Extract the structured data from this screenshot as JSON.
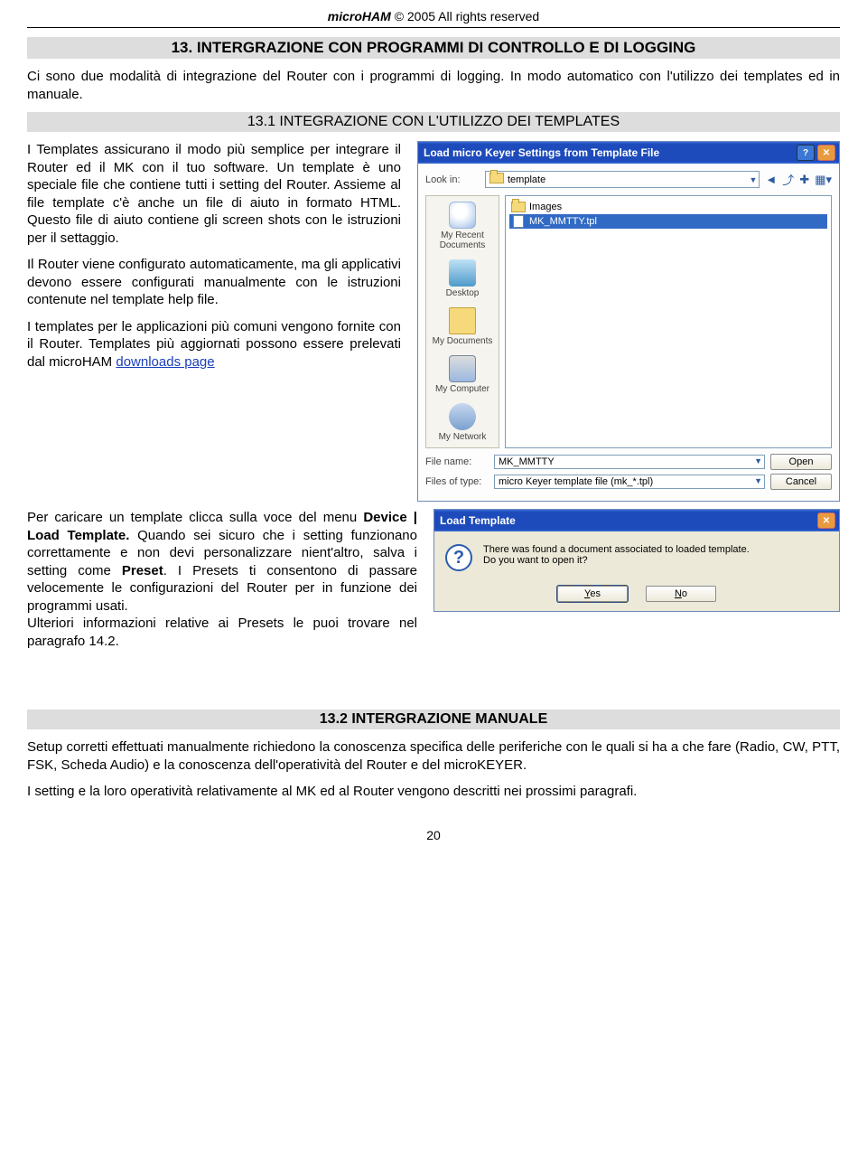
{
  "header": {
    "brand": "microHAM",
    "copyright": "© 2005  All rights reserved"
  },
  "section_title": "13. INTERGRAZIONE CON PROGRAMMI DI CONTROLLO E DI LOGGING",
  "intro": "Ci sono due modalità di integrazione del Router con i programmi di logging. In modo automatico con l'utilizzo dei templates ed in manuale.",
  "sub_title_1": "13.1 INTEGRAZIONE CON L'UTILIZZO DEI TEMPLATES",
  "para1": "I Templates assicurano il modo più semplice per integrare il Router ed il MK con il tuo software. Un template è uno speciale file che contiene tutti i setting del Router. Assieme al file template c'è anche un file di aiuto in formato HTML. Questo file di aiuto contiene gli  screen shots con le istruzioni per il settaggio.",
  "para2": "Il Router viene configurato automaticamente, ma gli applicativi devono essere configurati manualmente con le istruzioni contenute nel template help file.",
  "para3a": "I templates per le applicazioni più comuni vengono fornite con il Router. Templates più aggiornati possono essere prelevati dal microHAM ",
  "link_downloads": "downloads page",
  "para4a": "Per caricare un template clicca sulla voce del menu ",
  "para4b": "Device | Load Template.",
  "para4c": " Quando sei sicuro che i setting funzionano correttamente e non devi personalizzare nient'altro, salva i setting come ",
  "para4d": "Preset",
  "para4e": ". I Presets ti consentono di passare velocemente le configurazioni del Router per in funzione dei programmi usati.",
  "para4f": "Ulteriori informazioni relative ai Presets le puoi trovare nel paragrafo 14.2.",
  "sub_title_2": "13.2 INTERGRAZIONE  MANUALE",
  "para5": "Setup corretti effettuati manualmente richiedono la conoscenza specifica delle periferiche con le quali si ha a che fare (Radio, CW, PTT, FSK, Scheda Audio) e la conoscenza dell'operatività del Router e del microKEYER.",
  "para6": "I setting e la loro operatività relativamente al MK ed al Router vengono descritti nei prossimi paragrafi.",
  "page_number": "20",
  "dialog_open": {
    "title": "Load micro Keyer Settings from Template File",
    "lookin_label": "Look in:",
    "lookin_value": "template",
    "places": [
      {
        "name": "My Recent Documents"
      },
      {
        "name": "Desktop"
      },
      {
        "name": "My Documents"
      },
      {
        "name": "My Computer"
      },
      {
        "name": "My Network"
      }
    ],
    "files": [
      {
        "name": "Images",
        "type": "folder",
        "selected": false
      },
      {
        "name": "MK_MMTTY.tpl",
        "type": "file",
        "selected": true
      }
    ],
    "filename_label": "File name:",
    "filename_value": "MK_MMTTY",
    "filetype_label": "Files of type:",
    "filetype_value": "micro Keyer template file (mk_*.tpl)",
    "btn_open": "Open",
    "btn_cancel": "Cancel"
  },
  "dialog_msg": {
    "title": "Load Template",
    "text1": "There was found a document associated to loaded template.",
    "text2": "Do you want to open it?",
    "btn_yes": "Yes",
    "btn_no": "No"
  }
}
